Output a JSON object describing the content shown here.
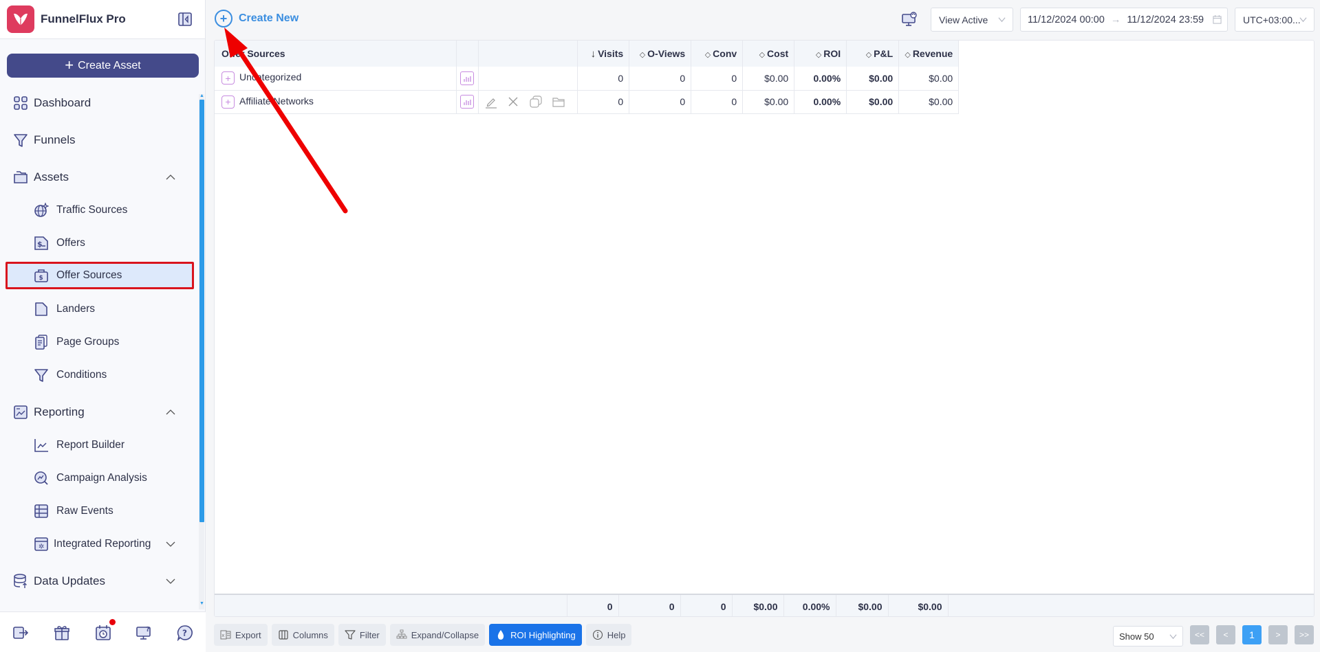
{
  "brand": {
    "name": "FunnelFlux Pro",
    "logo_color": "#de3b5e"
  },
  "sidebar": {
    "create_asset_label": "Create Asset",
    "items": [
      {
        "label": "Dashboard",
        "icon": "dashboard-icon"
      },
      {
        "label": "Funnels",
        "icon": "funnel-icon"
      },
      {
        "label": "Assets",
        "icon": "folder-icon",
        "expanded": true
      },
      {
        "label": "Traffic Sources",
        "icon": "globe-sparkle-icon"
      },
      {
        "label": "Offers",
        "icon": "dollar-document-icon"
      },
      {
        "label": "Offer Sources",
        "icon": "dollar-briefcase-icon",
        "active": true
      },
      {
        "label": "Landers",
        "icon": "page-icon"
      },
      {
        "label": "Page Groups",
        "icon": "pages-stack-icon"
      },
      {
        "label": "Conditions",
        "icon": "filter-icon"
      },
      {
        "label": "Reporting",
        "icon": "report-icon",
        "expanded": true
      },
      {
        "label": "Report Builder",
        "icon": "line-chart-icon"
      },
      {
        "label": "Campaign Analysis",
        "icon": "search-chart-icon"
      },
      {
        "label": "Raw Events",
        "icon": "table-icon"
      },
      {
        "label": "Integrated Reporting",
        "icon": "gear-window-icon",
        "expanded": false
      },
      {
        "label": "Data Updates",
        "icon": "database-upload-icon",
        "expanded": false
      }
    ],
    "footer_icons": [
      "logout-icon",
      "gift-icon",
      "calendar-clock-icon",
      "monitor-help-icon",
      "help-bubble-icon"
    ]
  },
  "toolbar": {
    "create_new_label": "Create New",
    "view_select": "View Active",
    "date_from": "11/12/2024 00:00",
    "date_to": "11/12/2024 23:59",
    "date_arrow": "→",
    "timezone": "UTC+03:00..."
  },
  "table": {
    "columns": [
      {
        "label": "Offer Sources",
        "sort": ""
      },
      {
        "label": "",
        "sort": ""
      },
      {
        "label": "",
        "sort": ""
      },
      {
        "label": "Visits",
        "sort": "↓"
      },
      {
        "label": "O-Views",
        "sort": "◇"
      },
      {
        "label": "Conv",
        "sort": "◇"
      },
      {
        "label": "Cost",
        "sort": "◇"
      },
      {
        "label": "ROI",
        "sort": "◇"
      },
      {
        "label": "P&L",
        "sort": "◇"
      },
      {
        "label": "Revenue",
        "sort": "◇"
      }
    ],
    "rows": [
      {
        "name": "Uncategorized",
        "visits": "0",
        "oviews": "0",
        "conv": "0",
        "cost": "$0.00",
        "roi": "0.00%",
        "pl": "$0.00",
        "revenue": "$0.00",
        "actions": false
      },
      {
        "name": "Affiliate Networks",
        "visits": "0",
        "oviews": "0",
        "conv": "0",
        "cost": "$0.00",
        "roi": "0.00%",
        "pl": "$0.00",
        "revenue": "$0.00",
        "actions": true
      }
    ],
    "totals": {
      "visits": "0",
      "oviews": "0",
      "conv": "0",
      "cost": "$0.00",
      "roi": "0.00%",
      "pl": "$0.00",
      "revenue": "$0.00"
    }
  },
  "bottom_bar": {
    "buttons": [
      "Export",
      "Columns",
      "Filter",
      "Expand/Collapse",
      "ROI Highlighting",
      "Help"
    ],
    "show_select": "Show 50",
    "pagination": {
      "first": "<<",
      "prev": "<",
      "current": "1",
      "next": ">",
      "last": ">>"
    }
  },
  "colors": {
    "accent": "#3b8ee0",
    "primary_button": "#1a73e8",
    "active_highlight": "#d9141d",
    "create_asset": "#444a8a",
    "annotation_arrow": "#ee0000"
  }
}
